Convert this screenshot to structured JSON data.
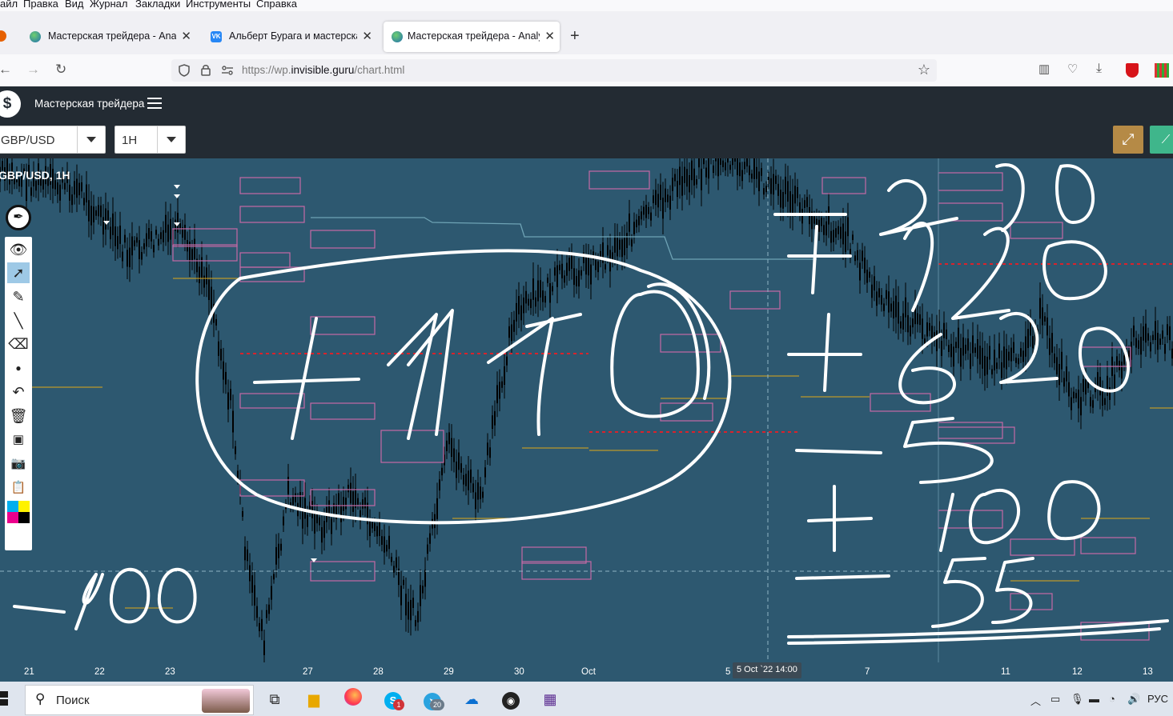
{
  "menu": [
    "айл",
    "Правка",
    "Вид",
    "Журнал",
    "Закладки",
    "Инструменты",
    "Справка"
  ],
  "tabs": [
    {
      "title": "Мастерская трейдера - Analysi",
      "close": "✕",
      "active": false
    },
    {
      "title": "Альберт Бурага и мастерская",
      "close": "✕",
      "active": false
    },
    {
      "title": "Мастерская трейдера - Analysi",
      "close": "✕",
      "active": true
    }
  ],
  "new_tab": "+",
  "nav": {
    "url_prefix": "https://wp.",
    "url_domain": "invisible.guru",
    "url_path": "/chart.html"
  },
  "app": {
    "logo": "$",
    "brand": "Мастерская трейдера"
  },
  "controls": {
    "symbol": "GBP/USD",
    "interval": "1H"
  },
  "chart": {
    "symbol_label": "GBP/USD, 1H",
    "x_axis_labels": [
      "21",
      "22",
      "23",
      "27",
      "28",
      "29",
      "30",
      "Oct",
      "5",
      "7",
      "11",
      "12",
      "13"
    ],
    "crosshair_label": "5 Oct `22  14:00",
    "handwritten": [
      "+1110",
      "+100",
      "-230",
      "+320",
      "+630",
      "-55",
      "+100",
      "-55"
    ],
    "colors": {
      "background": "#2d5870",
      "candles": "#000000",
      "zone_boxes": "#c56aa5",
      "levels": "#e0a818",
      "dashed": "#d9232b",
      "ink": "#ffffff"
    }
  },
  "chart_data": {
    "type": "candlestick",
    "title": "GBP/USD, 1H",
    "x_tick_labels": [
      "21",
      "22",
      "23",
      "27",
      "28",
      "29",
      "30",
      "Oct",
      "5",
      "7",
      "11",
      "12",
      "13"
    ]
  },
  "taskbar": {
    "search_label": "Поиск",
    "lang": "РУС",
    "skype_badge": "1",
    "telegram_badge": "20"
  }
}
